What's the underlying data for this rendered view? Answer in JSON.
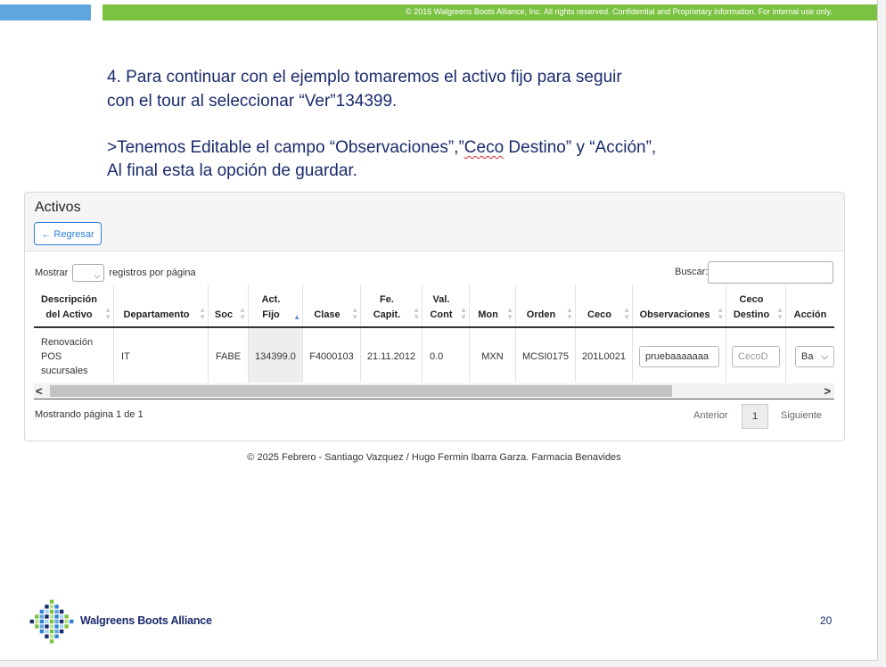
{
  "header": {
    "copyright": "© 2016 Walgreens Boots Alliance, Inc. All rights reserved. Confidential and Proprietary information. For internal use only."
  },
  "instructions": {
    "line1": "4. Para continuar con el ejemplo tomaremos el activo fijo para seguir",
    "line2": "con el tour al seleccionar “Ver”134399.",
    "line3_prefix": ">Tenemos Editable el campo “Observaciones”,”",
    "line3_ceco": "Ceco",
    "line3_suffix": " Destino” y “Acción”,",
    "line4": "Al final esta la opción de guardar."
  },
  "panel": {
    "title": "Activos",
    "back_button": "← Regresar"
  },
  "table_controls": {
    "show_prefix": "Mostrar",
    "show_suffix": "registros por página",
    "page_length_value": "",
    "search_label": "Buscar:",
    "search_value": ""
  },
  "table": {
    "columns": [
      {
        "line1": "Descripción",
        "line2": "del Activo",
        "sorted": false
      },
      {
        "line1": "",
        "line2": "Departamento",
        "sorted": false
      },
      {
        "line1": "",
        "line2": "Soc",
        "sorted": false
      },
      {
        "line1": "Act.",
        "line2": "Fijo",
        "sorted": true
      },
      {
        "line1": "",
        "line2": "Clase",
        "sorted": false
      },
      {
        "line1": "Fe.",
        "line2": "Capit.",
        "sorted": false
      },
      {
        "line1": "Val.",
        "line2": "Cont",
        "sorted": false
      },
      {
        "line1": "",
        "line2": "Mon",
        "sorted": false
      },
      {
        "line1": "",
        "line2": "Orden",
        "sorted": false
      },
      {
        "line1": "",
        "line2": "Ceco",
        "sorted": false
      },
      {
        "line1": "",
        "line2": "Observaciones",
        "sorted": false
      },
      {
        "line1": "Ceco",
        "line2": "Destino",
        "sorted": false
      },
      {
        "line1": "",
        "line2": "Acción",
        "sorted": false
      }
    ],
    "row": {
      "descripcion": [
        "Renovación",
        "POS",
        "sucursales"
      ],
      "departamento": "IT",
      "soc": "FABE",
      "act_fijo": "134399.0",
      "clase": "F4000103",
      "fe_capit": "21.11.2012",
      "val_cont": "0.0",
      "mon": "MXN",
      "orden": "MCSI0175",
      "ceco": "201L0021",
      "observaciones_value": "pruebaaaaaaa",
      "ceco_destino_placeholder": "CecoD",
      "accion_value": "Ba"
    }
  },
  "pagination": {
    "info": "Mostrando página 1 de 1",
    "previous": "Anterior",
    "current_page": "1",
    "next": "Siguiente"
  },
  "footer": {
    "text": "© 2025 Febrero - Santiago Vazquez / Hugo Fermin Ibarra Garza. Farmacia Benavides"
  },
  "branding": {
    "company": "Walgreens Boots Alliance",
    "logo_icon": "walgreens-logo-icon"
  },
  "slide": {
    "page_number": "20"
  },
  "colors": {
    "accent_blue": "#2f80d8",
    "header_green": "#7cc242",
    "header_blue": "#5ea6e0",
    "text_navy": "#1a2a6c"
  }
}
